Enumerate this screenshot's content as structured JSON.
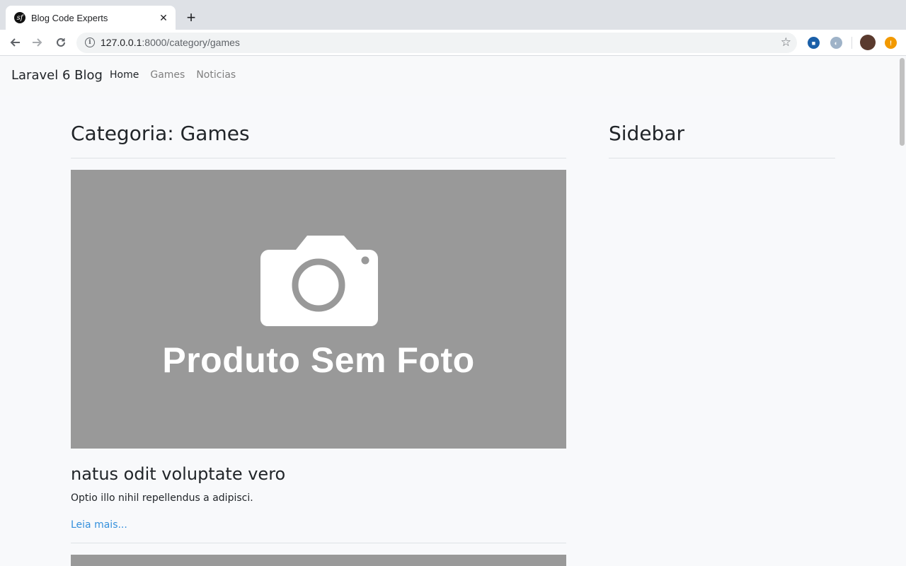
{
  "browser": {
    "tab_title": "Blog Code Experts",
    "url_host": "127.0.0.1",
    "url_path": ":8000/category/games"
  },
  "navbar": {
    "brand": "Laravel 6 Blog",
    "links": [
      "Home",
      "Games",
      "Noticias"
    ],
    "active": "Home"
  },
  "main": {
    "title": "Categoria: Games",
    "image_text": "Produto Sem Foto",
    "posts": [
      {
        "title": "natus odit voluptate vero",
        "excerpt": "Optio illo nihil repellendus a adipisci.",
        "read_more": "Leia mais..."
      }
    ]
  },
  "sidebar": {
    "title": "Sidebar"
  },
  "colors": {
    "link": "#3490dc",
    "placeholder_bg": "#999999",
    "page_bg": "#f8f9fb"
  },
  "icons": [
    "tab-favicon-icon",
    "close-icon",
    "plus-icon",
    "back-arrow-icon",
    "forward-arrow-icon",
    "reload-icon",
    "info-icon",
    "star-icon",
    "camera-icon"
  ]
}
